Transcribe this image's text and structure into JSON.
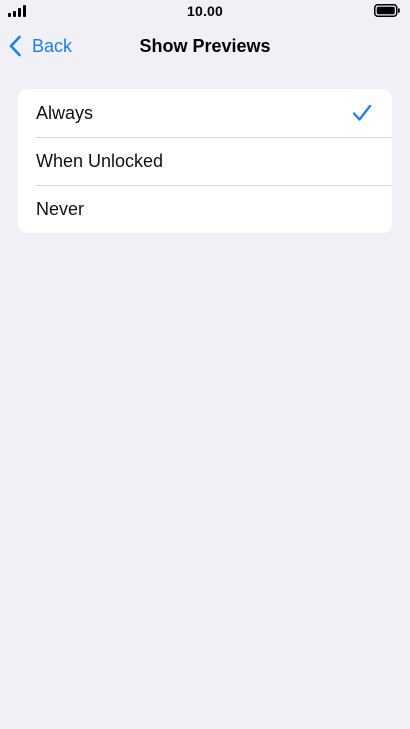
{
  "status_bar": {
    "time": "10.00",
    "signal_icon": "signal-bars-icon",
    "battery_icon": "battery-full-icon"
  },
  "nav": {
    "back_label": "Back",
    "back_icon": "chevron-left-icon",
    "title": "Show Previews"
  },
  "options": [
    {
      "label": "Always",
      "selected": true
    },
    {
      "label": "When Unlocked",
      "selected": false
    },
    {
      "label": "Never",
      "selected": false
    }
  ],
  "colors": {
    "accent": "#1a7ff5",
    "background": "#f1f0f6",
    "card": "#ffffff",
    "separator": "#d9d9dc"
  }
}
